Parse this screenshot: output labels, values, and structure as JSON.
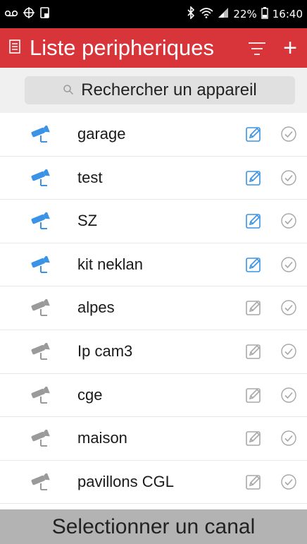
{
  "status": {
    "battery": "22%",
    "time": "16:40"
  },
  "header": {
    "title": "Liste peripheriques",
    "add_label": "+"
  },
  "search": {
    "placeholder": "Rechercher un appareil"
  },
  "devices": [
    {
      "name": "garage",
      "online": true
    },
    {
      "name": "test",
      "online": true
    },
    {
      "name": "SZ",
      "online": true
    },
    {
      "name": "kit neklan",
      "online": true
    },
    {
      "name": "alpes",
      "online": false
    },
    {
      "name": "Ip cam3",
      "online": false
    },
    {
      "name": "cge",
      "online": false
    },
    {
      "name": "maison",
      "online": false
    },
    {
      "name": "pavillons CGL",
      "online": false
    }
  ],
  "bottom": {
    "label": "Selectionner un canal"
  },
  "colors": {
    "header": "#d8353b",
    "online_icon": "#3a93e6",
    "offline_icon": "#9a9a9a",
    "check": "#a6a6a6"
  },
  "icons": {
    "camera": "camera-icon",
    "edit": "edit-icon",
    "check": "check-circle-icon",
    "menu": "menu-icon",
    "search": "search-icon"
  }
}
